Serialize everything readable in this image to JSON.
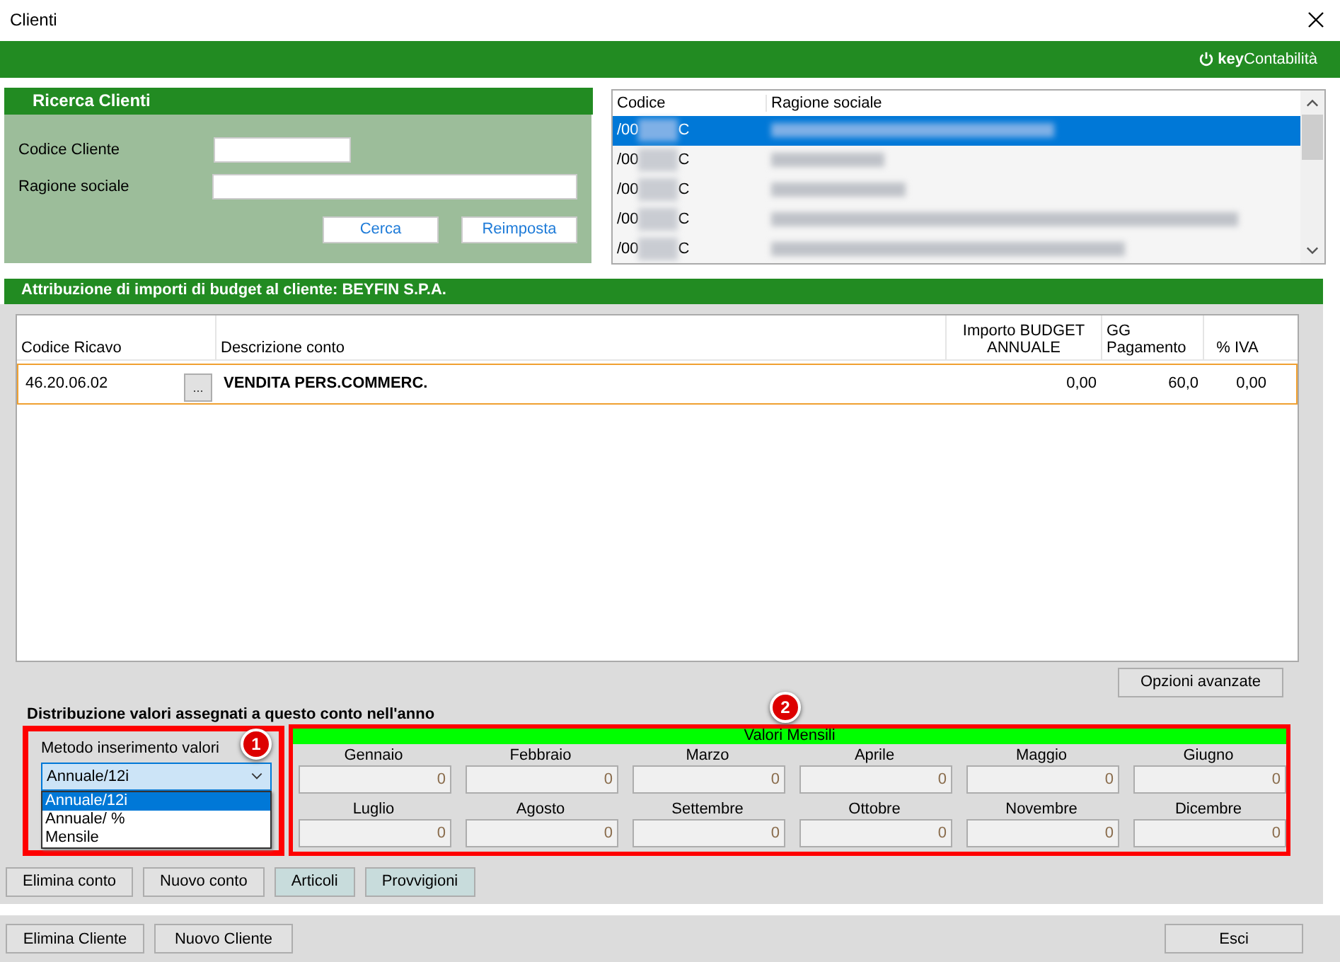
{
  "window": {
    "title": "Clienti"
  },
  "brand": {
    "text": "**key**Contabilità"
  },
  "search": {
    "title": "Ricerca Clienti",
    "fields": [
      {
        "label": "Codice Cliente",
        "kind": "short"
      },
      {
        "label": "Ragione sociale",
        "kind": "long"
      }
    ],
    "buttons": [
      "Cerca",
      "Reimposta"
    ]
  },
  "client_list": {
    "columns": [
      "Codice",
      "Ragione sociale"
    ],
    "rows": [
      {
        "code_prefix": "/00",
        "code_suffix": "C",
        "selected": true
      },
      {
        "code_prefix": "/00",
        "code_suffix": "C",
        "selected": false
      },
      {
        "code_prefix": "/00",
        "code_suffix": "C",
        "selected": false
      },
      {
        "code_prefix": "/00",
        "code_suffix": "C",
        "selected": false
      },
      {
        "code_prefix": "/00",
        "code_suffix": "C",
        "selected": false
      }
    ]
  },
  "budget": {
    "title": "Attribuzione di importi di budget al cliente: BEYFIN S.P.A.",
    "columns": [
      "Codice Ricavo",
      "Descrizione conto",
      "Importo BUDGET ANNUALE",
      "GG Pagamento",
      "% IVA"
    ],
    "rows": [
      {
        "code": "46.20.06.02",
        "lookup": "...",
        "description": "VENDITA PERS.COMMERC.",
        "amount": "0,00",
        "days": "60,0",
        "vat": "0,00",
        "selected": true
      }
    ]
  },
  "advanced_button": "Opzioni avanzate",
  "distribution": {
    "title": "Distribuzione valori assegnati a questo conto nell'anno",
    "method": {
      "label": "Metodo inserimento valori",
      "value": "Annuale/12i",
      "expanded": true,
      "options": [
        {
          "label": "Annuale/12i",
          "selected": true
        },
        {
          "label": "Annuale/ %",
          "selected": false
        },
        {
          "label": "Mensile",
          "selected": false
        }
      ]
    },
    "monthly": {
      "title": "Valori Mensili",
      "months": [
        {
          "label": "Gennaio",
          "value": "0"
        },
        {
          "label": "Febbraio",
          "value": "0"
        },
        {
          "label": "Marzo",
          "value": "0"
        },
        {
          "label": "Aprile",
          "value": "0"
        },
        {
          "label": "Maggio",
          "value": "0"
        },
        {
          "label": "Giugno",
          "value": "0"
        },
        {
          "label": "Luglio",
          "value": "0"
        },
        {
          "label": "Agosto",
          "value": "0"
        },
        {
          "label": "Settembre",
          "value": "0"
        },
        {
          "label": "Ottobre",
          "value": "0"
        },
        {
          "label": "Novembre",
          "value": "0"
        },
        {
          "label": "Dicembre",
          "value": "0"
        }
      ]
    }
  },
  "annotations": [
    "1",
    "2"
  ],
  "account_buttons": [
    {
      "label": "Elimina conto",
      "kind": "plain"
    },
    {
      "label": "Nuovo conto",
      "kind": "plain"
    },
    {
      "label": "Articoli",
      "kind": "tinted"
    },
    {
      "label": "Provvigioni",
      "kind": "tinted"
    }
  ],
  "footer": {
    "left_buttons": [
      "Elimina Cliente",
      "Nuovo Cliente"
    ],
    "right_buttons": [
      "Esci"
    ]
  }
}
